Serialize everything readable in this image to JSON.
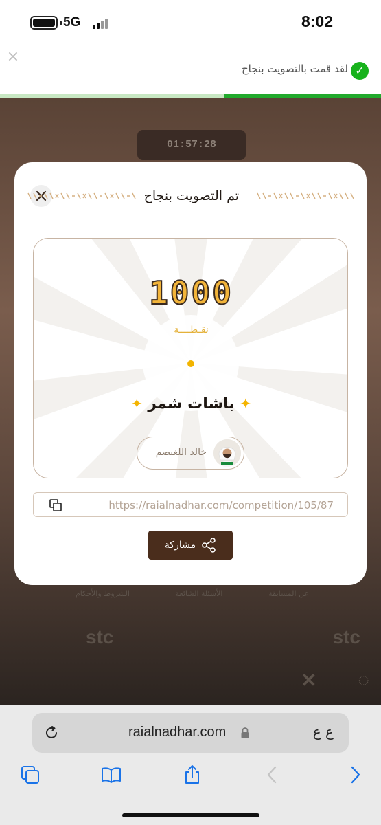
{
  "status_bar": {
    "network": "5G",
    "time": "8:02"
  },
  "toast": {
    "message": "لقد قمت بالتصويت بنجاح",
    "progress_fraction": 0.41
  },
  "background": {
    "counter": "01:57:28",
    "footer_links": [
      "عن المسابقة",
      "الأسئلة الشائعة",
      "الشروط والأحكام"
    ],
    "logos": [
      "stc",
      "stc"
    ]
  },
  "modal": {
    "title": "تم التصويت بنجاح",
    "points": "1000",
    "points_label": "نقـطــــة",
    "team_name": "باشات شمر",
    "voter_name": "خالد اللغيصم",
    "share_url": "https://raialnadhar.com/competition/105/87",
    "share_button": "مشاركة"
  },
  "browser": {
    "domain": "raialnadhar.com",
    "text_size_button": "ع ع"
  },
  "colors": {
    "success": "#17b21c",
    "brand_brown": "#4a2d1c",
    "gold": "#f2b43a"
  }
}
